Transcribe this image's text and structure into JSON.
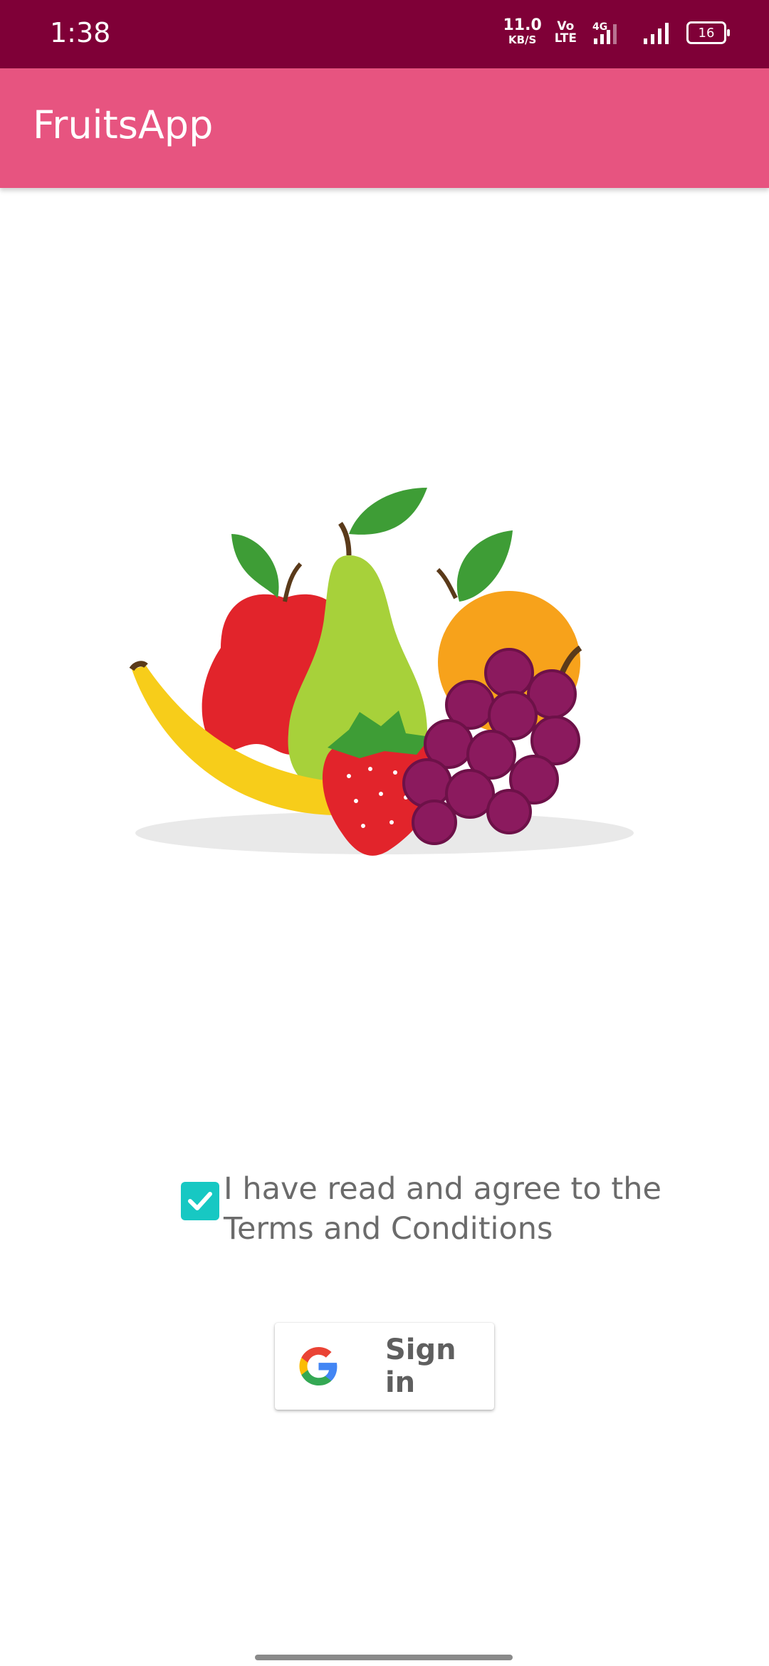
{
  "status_bar": {
    "time": "1:38",
    "net_speed_value": "11.0",
    "net_speed_unit": "KB/S",
    "volte": "Vo\nLTE",
    "network": "4G",
    "battery": "16",
    "bg_color": "#7f0037"
  },
  "app_bar": {
    "title": "FruitsApp",
    "bg_color": "#e75480"
  },
  "hero": {
    "image_name": "fruits-illustration"
  },
  "terms": {
    "checked": true,
    "text_line1": "I have read and agree to the",
    "text_line2": "Terms and Conditions",
    "checkbox_color": "#17c8c3"
  },
  "sign_in": {
    "label": "Sign in",
    "icon": "google-icon"
  }
}
